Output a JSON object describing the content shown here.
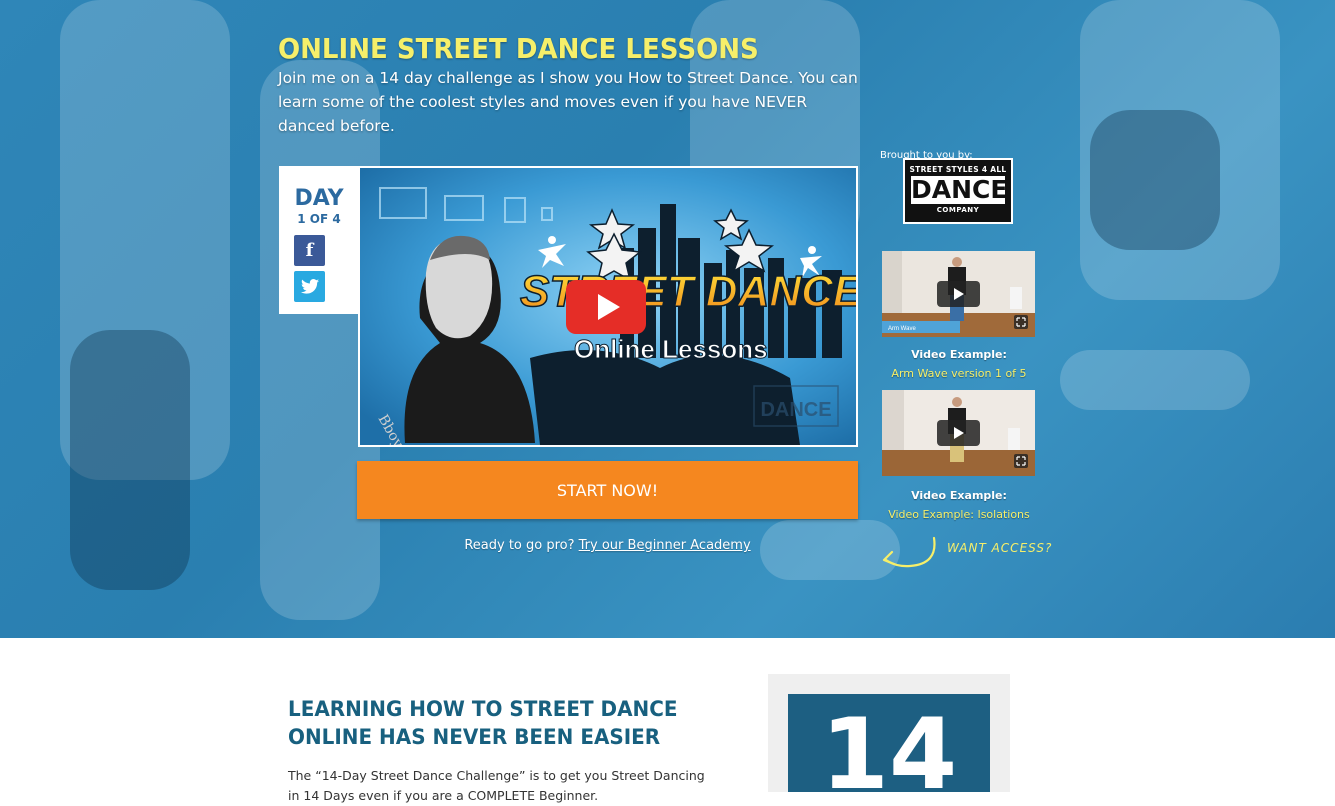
{
  "hero": {
    "title": "ONLINE STREET DANCE LESSONS",
    "intro": "Join me on a 14 day challenge as I show you How to Street Dance. You can learn some of the coolest styles and moves even if you have NEVER danced before."
  },
  "day_box": {
    "day_word": "DAY",
    "day_count": "1 OF 4",
    "facebook_icon": "f",
    "twitter_icon": "twitter-bird"
  },
  "main_video": {
    "title_line1": "STREET DANCE",
    "title_line2": "Online Lessons",
    "play_icon": "play-icon"
  },
  "cta": {
    "start_label": "START NOW!",
    "pro_text": "Ready to go pro?",
    "pro_link": "Try our Beginner Academy"
  },
  "sidebar": {
    "brought_by": "Brought to you by:",
    "logo_top": "STREET STYLES 4 ALL",
    "logo_mid": "DANCE",
    "logo_bot": "COMPANY",
    "videos": [
      {
        "label": "Video Example:",
        "title": "Arm Wave version 1 of 5",
        "tag": "Arm Wave"
      },
      {
        "label": "Video Example:",
        "title": "Video Example: Isolations"
      }
    ],
    "want_access": "WANT ACCESS?"
  },
  "section": {
    "title": "LEARNING HOW TO STREET DANCE ONLINE HAS NEVER BEEN EASIER",
    "body": "The “14-Day Street Dance Challenge” is to get you Street Dancing in 14 Days even if you are a COMPLETE Beginner.",
    "badge_number": "14"
  },
  "colors": {
    "title_yellow": "#f6ef6a",
    "cta_orange": "#f5871f",
    "hero_blue": "#2f86b8",
    "section_title": "#18607f"
  }
}
